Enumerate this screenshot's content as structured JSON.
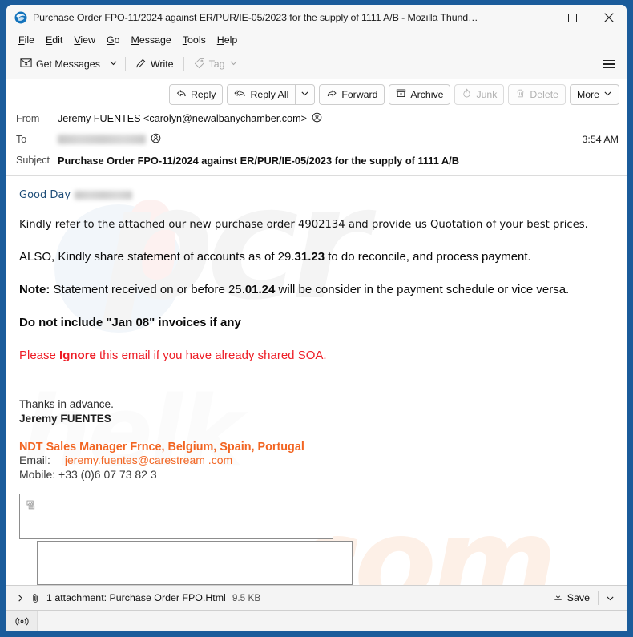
{
  "window": {
    "title": "Purchase Order FPO-11/2024 against ER/PUR/IE-05/2023 for the supply of 1111 A/B - Mozilla Thund…",
    "app_icon": "thunderbird-icon",
    "minimize_label": "Minimize",
    "maximize_label": "Maximize",
    "close_label": "Close"
  },
  "menubar": {
    "items": [
      {
        "label": "File",
        "accel": "F"
      },
      {
        "label": "Edit",
        "accel": "E"
      },
      {
        "label": "View",
        "accel": "V"
      },
      {
        "label": "Go",
        "accel": "G"
      },
      {
        "label": "Message",
        "accel": "M"
      },
      {
        "label": "Tools",
        "accel": "T"
      },
      {
        "label": "Help",
        "accel": "H"
      }
    ]
  },
  "toolbar": {
    "get_messages_label": "Get Messages",
    "get_messages_icon": "envelope-download-icon",
    "get_messages_caret_icon": "chevron-down-icon",
    "write_label": "Write",
    "write_icon": "pencil-icon",
    "tag_label": "Tag",
    "tag_icon": "tag-icon",
    "tag_caret_icon": "chevron-down-icon",
    "app_menu_icon": "hamburger-menu-icon"
  },
  "message_actions": {
    "reply_label": "Reply",
    "reply_icon": "reply-arrow-icon",
    "reply_all_label": "Reply All",
    "reply_all_icon": "reply-all-arrow-icon",
    "reply_all_caret_icon": "chevron-down-icon",
    "forward_label": "Forward",
    "forward_icon": "forward-arrow-icon",
    "archive_label": "Archive",
    "archive_icon": "archive-box-icon",
    "junk_label": "Junk",
    "junk_icon": "junk-flame-icon",
    "delete_label": "Delete",
    "delete_icon": "trash-icon",
    "more_label": "More",
    "more_caret_icon": "chevron-down-icon"
  },
  "headers": {
    "from_label": "From",
    "from_value": "Jeremy FUENTES <carolyn@newalbanychamber.com>",
    "from_contact_icon": "contact-circle-icon",
    "to_label": "To",
    "to_value_redacted": true,
    "to_contact_icon": "contact-circle-icon",
    "subject_label": "Subject",
    "subject_value": "Purchase Order FPO-11/2024 against ER/PUR/IE-05/2023 for the supply of 1111 A/B",
    "time": "3:54 AM"
  },
  "body": {
    "greeting": "Good Day",
    "greeting_redacted": true,
    "intro": "Kindly refer to the attached our new purchase order 4902134 and provide us Quotation of your best prices.",
    "also_prefix": "ALSO, Kindly share statement of accounts as of 29.",
    "also_bold": "31.23",
    "also_suffix": " to do reconcile, and process payment.",
    "note_label": "Note:",
    "note_prefix": " Statement received on or before 25.",
    "note_bold": "01.24",
    "note_suffix": " will be consider in the payment schedule or vice versa.",
    "do_not_include": "Do not include \"Jan 08\" invoices if any",
    "ignore_prefix": "Please ",
    "ignore_bold": "Ignore",
    "ignore_suffix": " this email if you have already shared SOA.",
    "thanks": "Thanks in advance.",
    "sender_name": "Jeremy FUENTES",
    "sig_title": "NDT Sales Manager Frnce, Belgium, Spain, Portugal",
    "email_label": "Email:",
    "email_value": "jeremy.fuentes@carestream .com",
    "mobile_line": "Mobile: +33 (0)6 07 73 82 3",
    "broken_image_icon": "broken-image-icon",
    "watermark_top": "pcr",
    "watermark_mid": "helk",
    "watermark_bottom": ".com"
  },
  "attachment": {
    "expand_icon": "chevron-right-icon",
    "paperclip_icon": "paperclip-icon",
    "summary": "1 attachment: Purchase Order FPO.Html",
    "size": "9.5 KB",
    "save_label": "Save",
    "save_icon": "download-icon",
    "save_caret_icon": "chevron-down-icon"
  },
  "statusbar": {
    "connection_icon": "broadcast-signal-icon"
  },
  "colors": {
    "frame": "#1b5c9b",
    "accent_orange": "#f26522",
    "alert_red": "#ee1c25",
    "greeting_blue": "#1f4e79"
  }
}
